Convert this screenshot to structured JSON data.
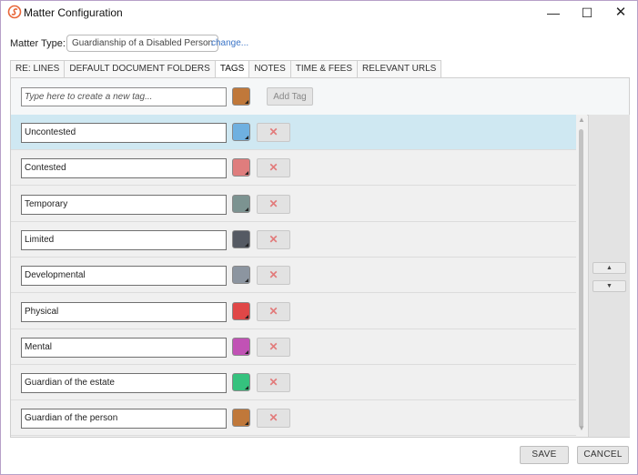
{
  "window": {
    "title": "Matter Configuration",
    "minimize_glyph": "—",
    "maximize_glyph": "☐",
    "close_glyph": "✕"
  },
  "matter": {
    "label": "Matter Type:",
    "value": "Guardianship of a Disabled Person",
    "change_link": "change..."
  },
  "tabs": [
    {
      "label": "RE: LINES",
      "active": false
    },
    {
      "label": "DEFAULT DOCUMENT FOLDERS",
      "active": false
    },
    {
      "label": "TAGS",
      "active": true
    },
    {
      "label": "NOTES",
      "active": false
    },
    {
      "label": "TIME & FEES",
      "active": false
    },
    {
      "label": "RELEVANT URLS",
      "active": false
    }
  ],
  "new_tag": {
    "placeholder": "Type here to create a new tag...",
    "color": "#c0783a",
    "add_label": "Add Tag"
  },
  "tags": [
    {
      "name": "Uncontested",
      "color": "#6fb0e0",
      "selected": true
    },
    {
      "name": "Contested",
      "color": "#df7d7d",
      "selected": false
    },
    {
      "name": "Temporary",
      "color": "#7c9391",
      "selected": false
    },
    {
      "name": "Limited",
      "color": "#555a63",
      "selected": false
    },
    {
      "name": "Developmental",
      "color": "#8c95a0",
      "selected": false
    },
    {
      "name": "Physical",
      "color": "#e04747",
      "selected": false
    },
    {
      "name": "Mental",
      "color": "#c152b5",
      "selected": false
    },
    {
      "name": "Guardian of the estate",
      "color": "#35c27e",
      "selected": false
    },
    {
      "name": "Guardian of the person",
      "color": "#c0783a",
      "selected": false
    }
  ],
  "delete_glyph": "✕",
  "scroll": {
    "up_glyph": "▲",
    "down_glyph": "▼"
  },
  "reorder": {
    "up_glyph": "▲",
    "down_glyph": "▼"
  },
  "footer": {
    "save_label": "SAVE",
    "cancel_label": "CANCEL"
  },
  "colors": {
    "selected_row": "#cfe8f2",
    "link": "#3a74c7",
    "logo": "#e8673a"
  }
}
